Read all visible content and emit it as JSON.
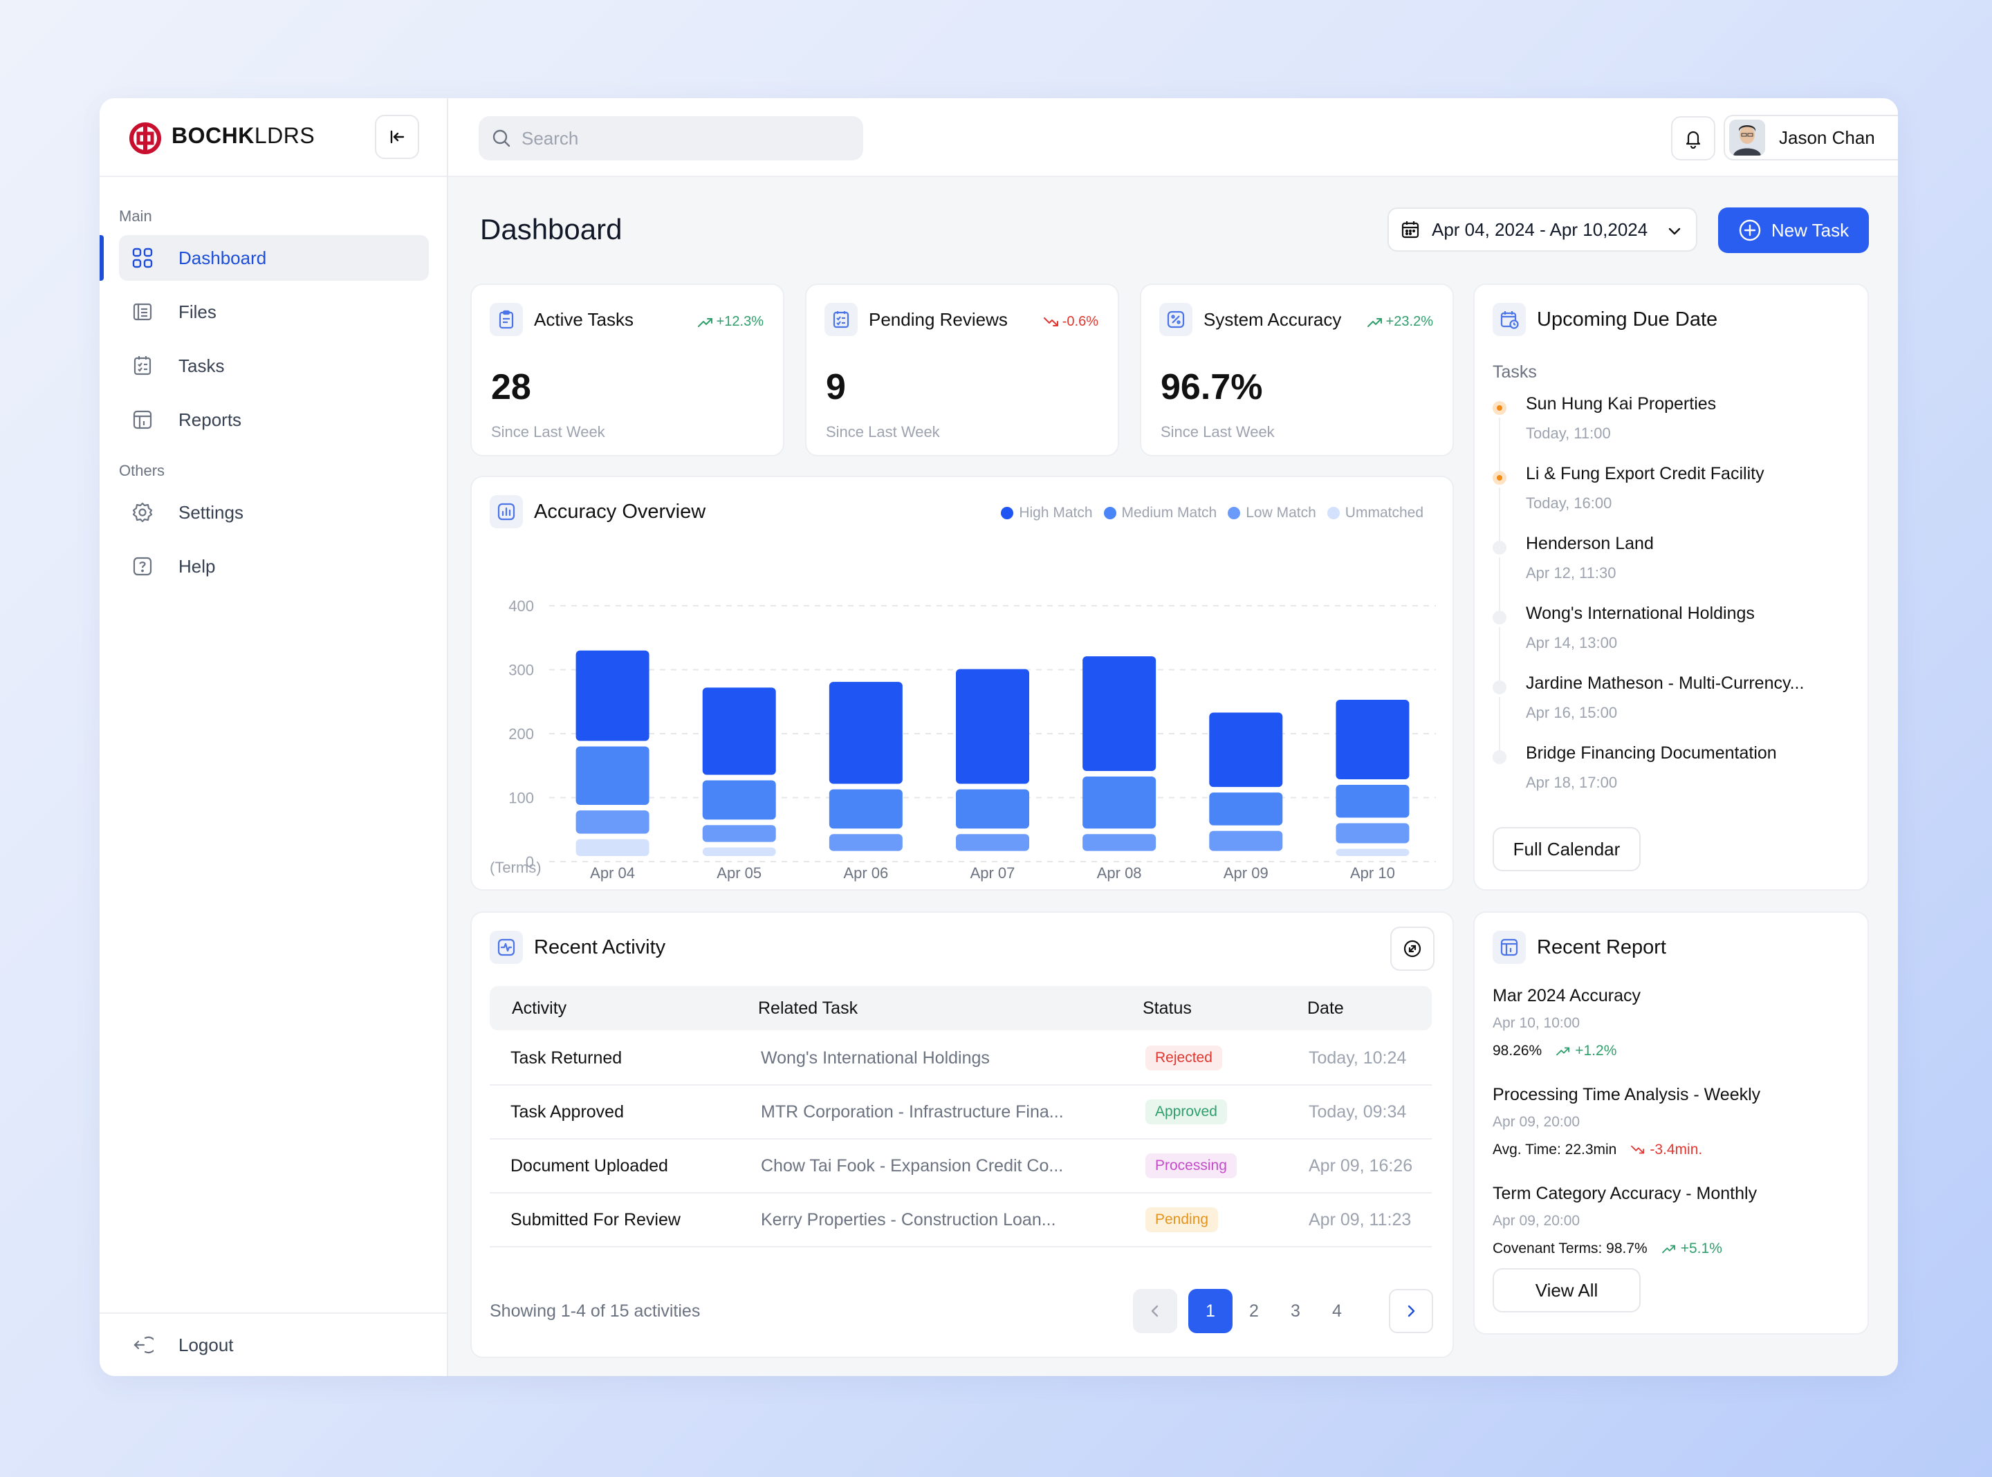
{
  "brand": {
    "name_bold": "BOCHK",
    "name_light": "LDRS"
  },
  "colors": {
    "accent": "#2a5ef0",
    "brand_red": "#c8102e",
    "up": "#2e9f6b",
    "down": "#e0362f"
  },
  "sidebar": {
    "main_label": "Main",
    "others_label": "Others",
    "items": [
      {
        "label": "Dashboard",
        "icon": "grid-icon",
        "active": true
      },
      {
        "label": "Files",
        "icon": "file-icon"
      },
      {
        "label": "Tasks",
        "icon": "checklist-icon"
      },
      {
        "label": "Reports",
        "icon": "report-icon"
      }
    ],
    "others": [
      {
        "label": "Settings",
        "icon": "gear-icon"
      },
      {
        "label": "Help",
        "icon": "help-icon"
      }
    ],
    "logout": "Logout"
  },
  "header": {
    "search_placeholder": "Search",
    "user_name": "Jason Chan"
  },
  "page": {
    "title": "Dashboard",
    "date_range": "Apr 04, 2024 - Apr 10,2024",
    "new_task": "New Task"
  },
  "stats": [
    {
      "title": "Active Tasks",
      "delta": "+12.3%",
      "trend": "up",
      "value": "28",
      "sub": "Since Last Week"
    },
    {
      "title": "Pending Reviews",
      "delta": "-0.6%",
      "trend": "down",
      "value": "9",
      "sub": "Since Last Week"
    },
    {
      "title": "System Accuracy",
      "delta": "+23.2%",
      "trend": "up",
      "value": "96.7%",
      "sub": "Since Last Week"
    }
  ],
  "accuracy": {
    "title": "Accuracy Overview",
    "legend": [
      "High Match",
      "Medium Match",
      "Low Match",
      "Ummatched"
    ]
  },
  "chart_data": {
    "type": "bar",
    "stacked": true,
    "categories": [
      "Apr 04",
      "Apr 05",
      "Apr 06",
      "Apr 07",
      "Apr 08",
      "Apr 09",
      "Apr 10"
    ],
    "series": [
      {
        "name": "Ummatched",
        "color": "#d3e1fd",
        "values": [
          35,
          22,
          8,
          8,
          8,
          8,
          20
        ]
      },
      {
        "name": "Low Match",
        "color": "#6b9bfa",
        "values": [
          45,
          35,
          35,
          35,
          35,
          40,
          40
        ]
      },
      {
        "name": "Medium Match",
        "color": "#4a85f7",
        "values": [
          100,
          70,
          70,
          70,
          90,
          60,
          60
        ]
      },
      {
        "name": "High Match",
        "color": "#1f55f2",
        "values": [
          150,
          145,
          168,
          188,
          188,
          125,
          133
        ]
      }
    ],
    "ylabel": "(Terms)",
    "yticks": [
      0,
      100,
      200,
      300,
      400
    ],
    "ylim": [
      0,
      400
    ],
    "grid": true,
    "legend_position": "top-right"
  },
  "upcoming": {
    "title": "Upcoming Due Date",
    "subtitle": "Tasks",
    "items": [
      {
        "name": "Sun Hung Kai Properties",
        "time": "Today, 11:00",
        "urgent": true
      },
      {
        "name": "Li & Fung Export Credit Facility",
        "time": "Today, 16:00",
        "urgent": true
      },
      {
        "name": "Henderson Land",
        "time": "Apr 12, 11:30",
        "urgent": false
      },
      {
        "name": "Wong's International Holdings",
        "time": "Apr 14, 13:00",
        "urgent": false
      },
      {
        "name": "Jardine Matheson - Multi-Currency...",
        "time": "Apr 16, 15:00",
        "urgent": false
      },
      {
        "name": "Bridge Financing Documentation",
        "time": "Apr 18, 17:00",
        "urgent": false
      }
    ],
    "button": "Full Calendar"
  },
  "activity": {
    "title": "Recent Activity",
    "columns": [
      "Activity",
      "Related Task",
      "Status",
      "Date"
    ],
    "rows": [
      {
        "activity": "Task Returned",
        "task": "Wong's International Holdings",
        "status": "Rejected",
        "status_type": "rejected",
        "date": "Today, 10:24"
      },
      {
        "activity": "Task Approved",
        "task": "MTR Corporation - Infrastructure Fina...",
        "status": "Approved",
        "status_type": "approved",
        "date": "Today, 09:34"
      },
      {
        "activity": "Document Uploaded",
        "task": "Chow Tai Fook - Expansion Credit Co...",
        "status": "Processing",
        "status_type": "processing",
        "date": "Apr 09, 16:26"
      },
      {
        "activity": "Submitted For Review",
        "task": "Kerry Properties - Construction Loan...",
        "status": "Pending",
        "status_type": "pending",
        "date": "Apr 09, 11:23"
      }
    ],
    "footer": "Showing 1-4 of 15 activities",
    "pages": [
      "1",
      "2",
      "3",
      "4"
    ],
    "current_page": "1"
  },
  "report": {
    "title": "Recent Report",
    "items": [
      {
        "title": "Mar 2024 Accuracy",
        "time": "Apr 10, 10:00",
        "metric": "98.26%",
        "delta": "+1.2%",
        "trend": "up"
      },
      {
        "title": "Processing Time Analysis - Weekly",
        "time": "Apr 09, 20:00",
        "metric": "Avg. Time: 22.3min",
        "delta": "-3.4min.",
        "trend": "down"
      },
      {
        "title": "Term Category Accuracy - Monthly",
        "time": "Apr 09, 20:00",
        "metric": "Covenant Terms: 98.7%",
        "delta": "+5.1%",
        "trend": "up"
      }
    ],
    "button": "View All"
  }
}
